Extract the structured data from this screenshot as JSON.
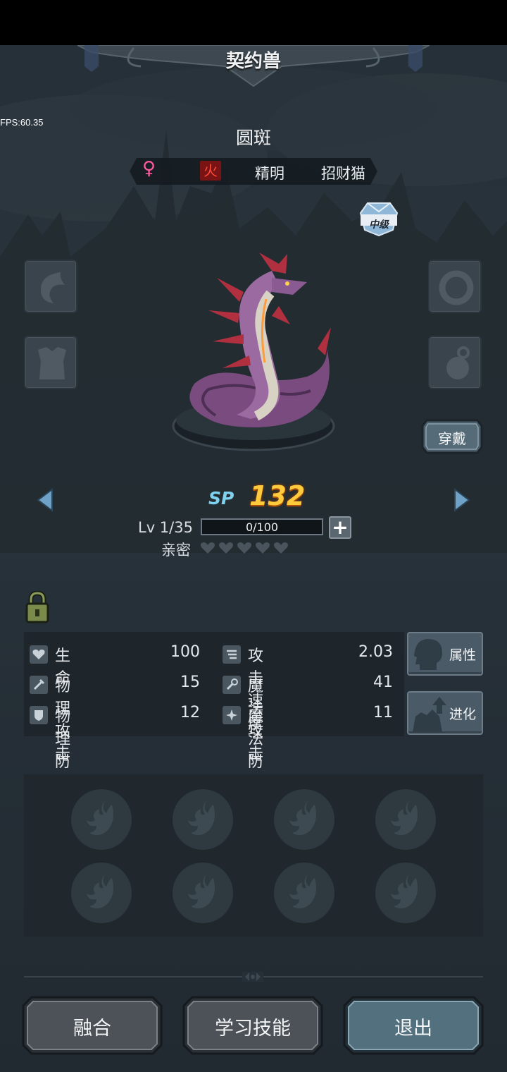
{
  "header": {
    "title": "契约兽"
  },
  "debug": {
    "fps": "FPS:60.35"
  },
  "pet": {
    "name": "圆斑",
    "gender_symbol": "♀",
    "element": "火",
    "traits": [
      "精明",
      "招财猫"
    ],
    "rank": "中级",
    "icon": "serpent-dragon"
  },
  "equipment": {
    "left_slots": [
      "horn-slot-icon",
      "armor-slot-icon"
    ],
    "right_slots": [
      "ring-slot-icon",
      "bell-slot-icon"
    ],
    "wear_label": "穿戴"
  },
  "progress": {
    "sp_label": "SP",
    "sp_value": "132",
    "level_label": "Lv 1/35",
    "exp_text": "0/100",
    "exp_fraction": 0,
    "intimacy_label": "亲密",
    "intimacy_hearts": 5,
    "intimacy_filled": 0
  },
  "stats": [
    {
      "label": "生　　命",
      "value": "100",
      "icon": "heart-icon"
    },
    {
      "label": "攻击速度",
      "value": "2.03",
      "icon": "speed-icon"
    },
    {
      "label": "物理攻击",
      "value": "15",
      "icon": "sword-icon"
    },
    {
      "label": "魔法攻击",
      "value": "41",
      "icon": "wand-icon"
    },
    {
      "label": "物理防御",
      "value": "12",
      "icon": "shield-icon"
    },
    {
      "label": "魔法防御",
      "value": "11",
      "icon": "magic-shield-icon"
    }
  ],
  "side_buttons": {
    "attributes": "属性",
    "evolve": "进化"
  },
  "skills": {
    "slot_count": 8,
    "icon": "flame-skill-icon"
  },
  "bottom_buttons": {
    "fuse": "融合",
    "learn": "学习技能",
    "exit": "退出"
  },
  "colors": {
    "background": "#263038",
    "sp_value": "#ffcb3c",
    "sp_label": "#7fd2ef",
    "element_bg": "#7a1414",
    "gender": "#ff5a9c",
    "exit_button": "#52707e"
  }
}
